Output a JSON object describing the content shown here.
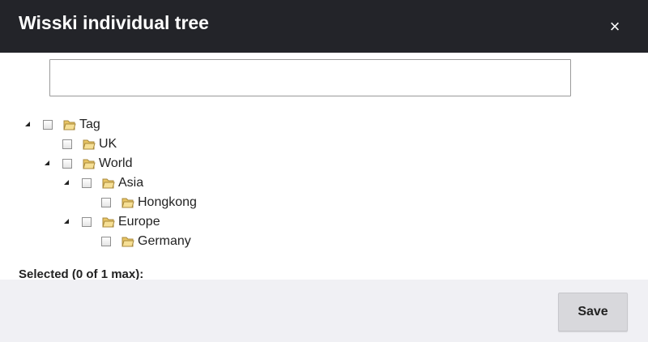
{
  "dialog": {
    "title": "Wisski individual tree",
    "close_symbol": "×",
    "close_icon": "close-icon"
  },
  "search": {
    "value": "",
    "placeholder": ""
  },
  "tree": {
    "icons": {
      "expand": "triangle-down-icon",
      "folder": "folder-icon"
    },
    "nodes": [
      {
        "label": "Tag",
        "level": 0,
        "expanded": true,
        "checked": false
      },
      {
        "label": "UK",
        "level": 1,
        "expanded": false,
        "checked": false
      },
      {
        "label": "World",
        "level": 1,
        "expanded": true,
        "checked": false
      },
      {
        "label": "Asia",
        "level": 2,
        "expanded": true,
        "checked": false
      },
      {
        "label": "Hongkong",
        "level": 3,
        "expanded": false,
        "checked": false
      },
      {
        "label": "Europe",
        "level": 2,
        "expanded": true,
        "checked": false
      },
      {
        "label": "Germany",
        "level": 3,
        "expanded": false,
        "checked": false
      }
    ]
  },
  "selection": {
    "text": "Selected (0 of 1 max):"
  },
  "footer": {
    "save_label": "Save"
  },
  "colors": {
    "titlebar": "#232429",
    "footer": "#f0f0f4",
    "button": "#d8d8dc",
    "folder": "#f2d688"
  }
}
